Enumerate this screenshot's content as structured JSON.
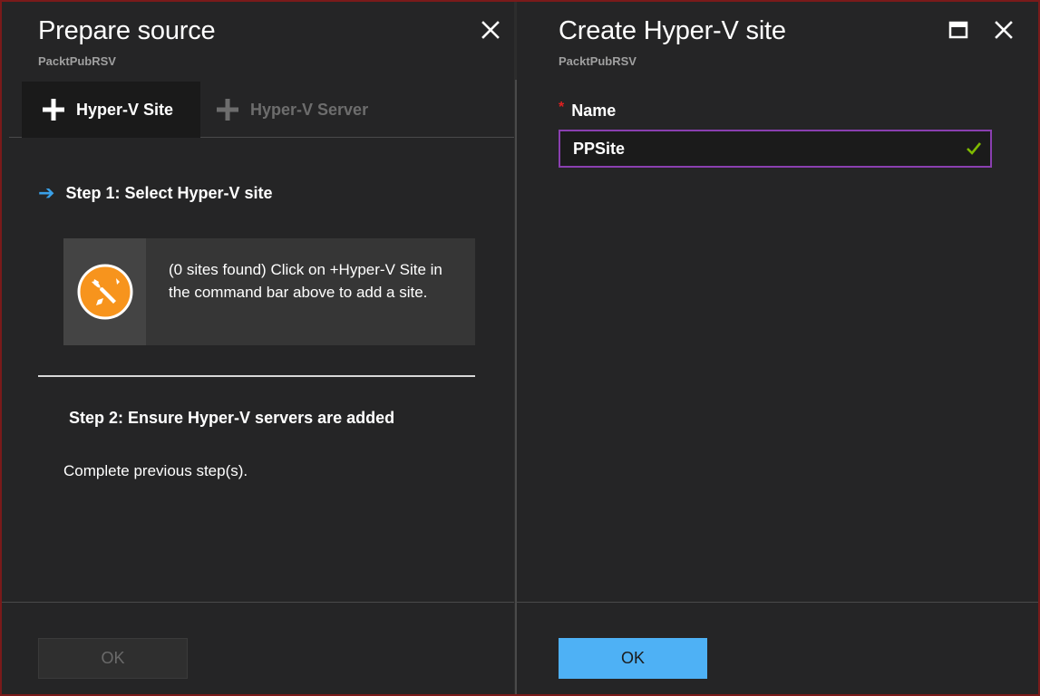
{
  "left_blade": {
    "title": "Prepare source",
    "subtitle": "PacktPubRSV",
    "commands": [
      {
        "label": "Hyper-V Site",
        "icon": "plus-icon",
        "enabled": true
      },
      {
        "label": "Hyper-V Server",
        "icon": "plus-icon",
        "enabled": false
      }
    ],
    "step1": {
      "label": "Step 1: Select Hyper-V site",
      "icon": "arrow-right-icon"
    },
    "info_card": {
      "icon": "tools-icon",
      "text": "(0 sites found) Click on +Hyper-V Site in the command bar above to add a site."
    },
    "step2": {
      "label": "Step 2: Ensure Hyper-V servers are added",
      "description": "Complete previous step(s)."
    },
    "ok_label": "OK"
  },
  "right_blade": {
    "title": "Create Hyper-V site",
    "subtitle": "PacktPubRSV",
    "name_field": {
      "required_marker": "*",
      "label": "Name",
      "value": "PPSite"
    },
    "ok_label": "OK"
  },
  "colors": {
    "background": "#252526",
    "accent_blue": "#4eb1f5",
    "input_border": "#8a3fb0",
    "valid_green": "#7fba00",
    "tools_orange": "#f7941d",
    "required_red": "#e02020"
  }
}
